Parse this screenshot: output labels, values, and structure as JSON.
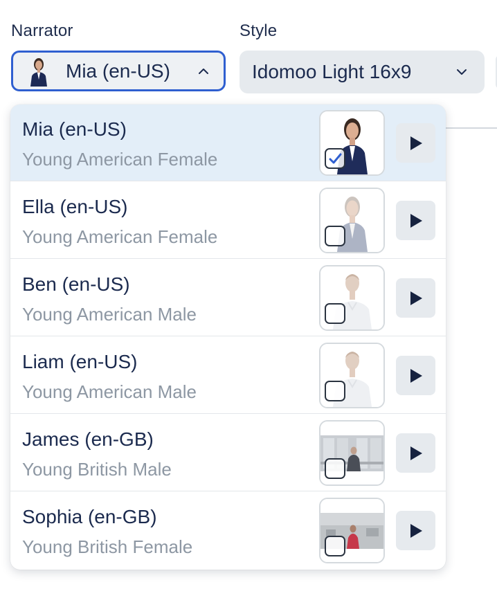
{
  "narrator": {
    "label": "Narrator",
    "selected_value": "Mia (en-US)",
    "expanded": true
  },
  "style": {
    "label": "Style",
    "selected_value": "Idomoo Light 16x9"
  },
  "colors": {
    "accent": "#2f5fd0",
    "selected_row_bg": "#e3eef8",
    "text_primary": "#1b2a4e",
    "text_secondary": "#8d97a3",
    "button_bg": "#e6eaee"
  },
  "options": [
    {
      "name": "Mia (en-US)",
      "description": "Young American Female",
      "checked": true,
      "thumbnail": "woman-dark-suit",
      "play_icon": "play-icon"
    },
    {
      "name": "Ella (en-US)",
      "description": "Young American Female",
      "checked": false,
      "thumbnail": "woman-grey-suit",
      "play_icon": "play-icon"
    },
    {
      "name": "Ben (en-US)",
      "description": "Young American Male",
      "checked": false,
      "thumbnail": "man-white-shirt",
      "play_icon": "play-icon"
    },
    {
      "name": "Liam (en-US)",
      "description": "Young American Male",
      "checked": false,
      "thumbnail": "man-white-shirt",
      "play_icon": "play-icon"
    },
    {
      "name": "James (en-GB)",
      "description": "Young British Male",
      "checked": false,
      "thumbnail": "man-office-window",
      "play_icon": "play-icon"
    },
    {
      "name": "Sophia (en-GB)",
      "description": "Young British Female",
      "checked": false,
      "thumbnail": "woman-office",
      "play_icon": "play-icon"
    }
  ]
}
